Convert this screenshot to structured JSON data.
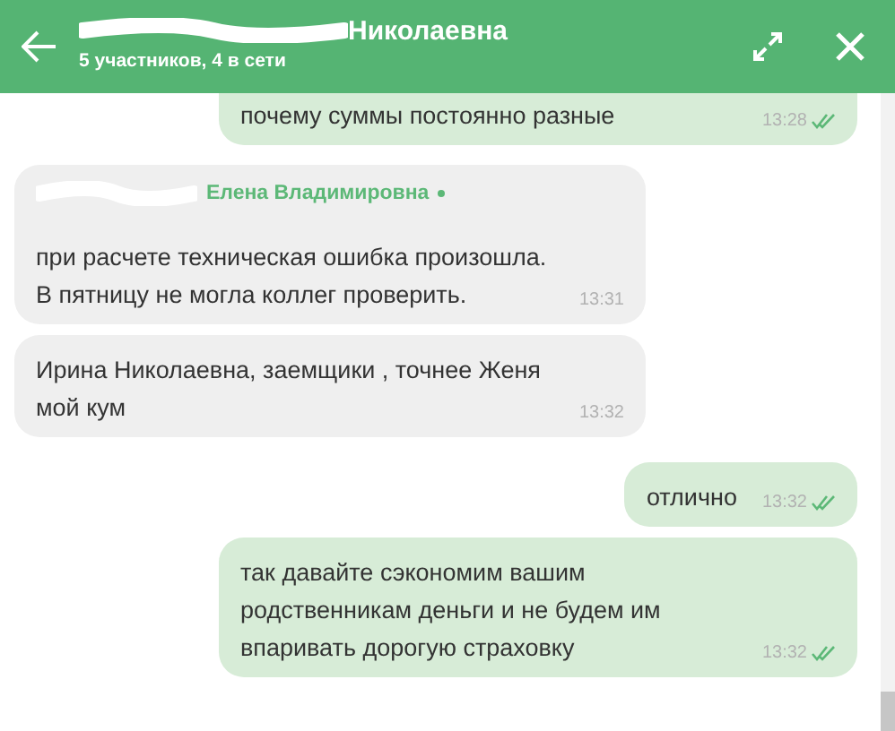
{
  "header": {
    "title": "Николаевна",
    "title_redacted": true,
    "subtitle": "5 участников, 4 в сети"
  },
  "messages": [
    {
      "kind": "outgoing",
      "text": "почему суммы постоянно разные",
      "time": "13:28",
      "read": true
    },
    {
      "kind": "incoming",
      "sender": "Елена Владимировна",
      "sender_redacted": true,
      "online": true,
      "text": "при расчете техническая ошибка произошла. В пятницу не могла коллег проверить.",
      "time": "13:31"
    },
    {
      "kind": "incoming",
      "text": "Ирина Николаевна, заемщики , точнее Женя мой кум",
      "time": "13:32"
    },
    {
      "kind": "outgoing",
      "text": "отлично",
      "time": "13:32",
      "read": true
    },
    {
      "kind": "outgoing",
      "text": "так давайте сэкономим вашим родственникам деньги и не будем им впаривать дорогую страховку",
      "time": "13:32",
      "read": true
    }
  ]
}
